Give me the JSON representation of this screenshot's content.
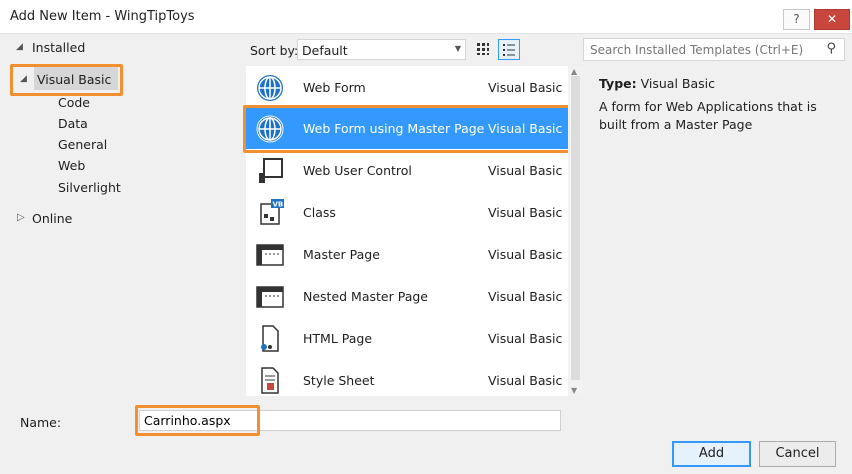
{
  "window": {
    "title": "Add New Item - WingTipToys",
    "help_label": "?",
    "close_label": "✕"
  },
  "tree": {
    "installed": "Installed",
    "selected": "Visual Basic",
    "children": [
      "Code",
      "Data",
      "General",
      "Web",
      "Silverlight"
    ],
    "online": "Online"
  },
  "toolbar": {
    "sort_label": "Sort by:",
    "sort_value": "Default",
    "search_placeholder": "Search Installed Templates (Ctrl+E)"
  },
  "templates": [
    {
      "name": "Web Form",
      "lang": "Visual Basic",
      "icon": "globe-icon"
    },
    {
      "name": "Web Form using Master Page",
      "lang": "Visual Basic",
      "icon": "globe-icon",
      "selected": true
    },
    {
      "name": "Web User Control",
      "lang": "Visual Basic",
      "icon": "user-control-icon"
    },
    {
      "name": "Class",
      "lang": "Visual Basic",
      "icon": "vb-class-icon"
    },
    {
      "name": "Master Page",
      "lang": "Visual Basic",
      "icon": "master-page-icon"
    },
    {
      "name": "Nested Master Page",
      "lang": "Visual Basic",
      "icon": "master-page-icon"
    },
    {
      "name": "HTML Page",
      "lang": "Visual Basic",
      "icon": "html-page-icon"
    },
    {
      "name": "Style Sheet",
      "lang": "Visual Basic",
      "icon": "style-sheet-icon"
    }
  ],
  "details": {
    "type_label": "Type:",
    "type_value": "Visual Basic",
    "description": "A form for Web Applications that is built from a Master Page"
  },
  "form": {
    "name_label": "Name:",
    "name_value": "Carrinho.aspx"
  },
  "buttons": {
    "add": "Add",
    "cancel": "Cancel"
  },
  "colors": {
    "selection": "#3399ff",
    "highlight": "#f28f2e",
    "close": "#c9463d"
  }
}
